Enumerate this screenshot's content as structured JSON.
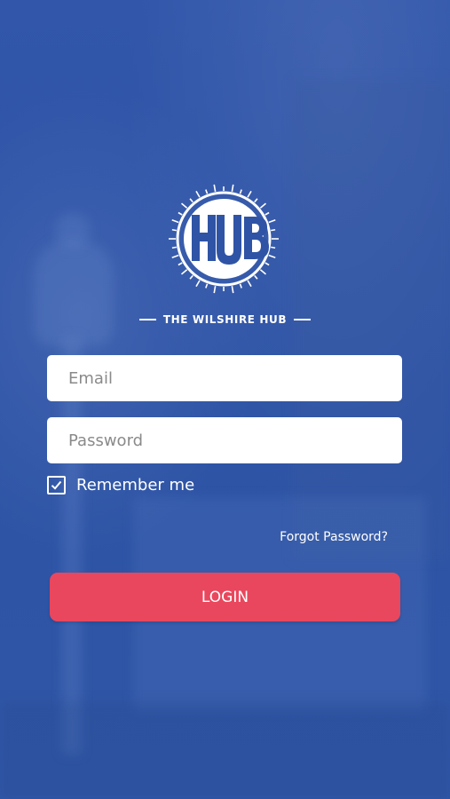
{
  "brand": {
    "logo_text": "HUB",
    "name": "THE WILSHIRE HUB"
  },
  "form": {
    "email_placeholder": "Email",
    "email_value": "",
    "password_placeholder": "Password",
    "password_value": "",
    "remember_label": "Remember me",
    "remember_checked": true,
    "forgot_label": "Forgot Password?",
    "login_label": "LOGIN"
  },
  "icons": {
    "logo": "hub-sunburst-logo-icon",
    "checkbox": "checkmark-icon"
  },
  "colors": {
    "background": "#2f54a6",
    "login_button": "#e9475d",
    "field_background": "#ffffff",
    "text_light": "#ffffff"
  }
}
